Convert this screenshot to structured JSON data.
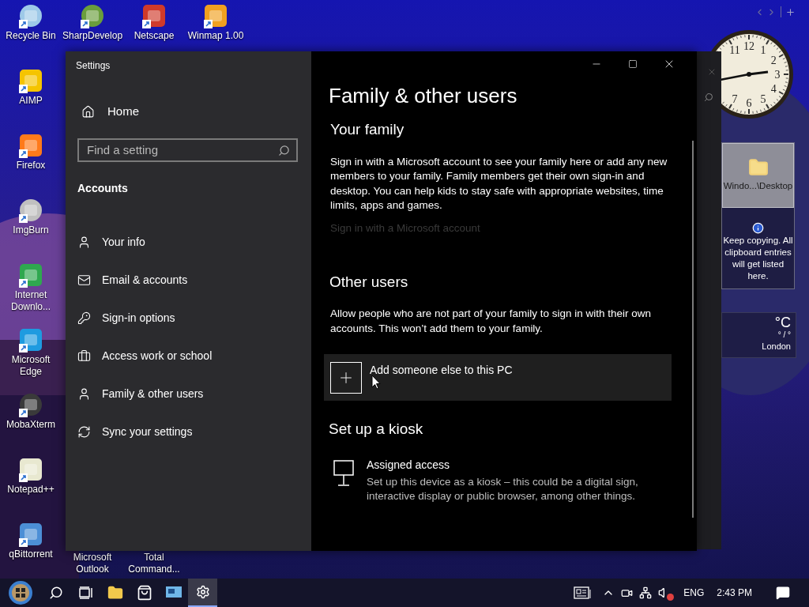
{
  "desktop_icons": {
    "column": [
      {
        "label": "Recycle Bin"
      },
      {
        "label": "AIMP"
      },
      {
        "label": "Firefox"
      },
      {
        "label": "ImgBurn"
      },
      {
        "label": "Internet Downlo..."
      },
      {
        "label": "Microsoft Edge"
      },
      {
        "label": "MobaXterm"
      },
      {
        "label": "Notepad++"
      },
      {
        "label": "qBittorrent"
      }
    ],
    "top_row": [
      {
        "label": "SharpDevelop"
      },
      {
        "label": "Netscape"
      },
      {
        "label": "Winmap 1.00"
      }
    ],
    "bottom_row": [
      {
        "label": "Microsoft Outlook"
      },
      {
        "label": "Total Command..."
      }
    ]
  },
  "settings": {
    "title": "Settings",
    "sidebar": {
      "home": "Home",
      "search": {
        "placeholder": "Find a setting"
      },
      "section": "Accounts",
      "items": [
        {
          "label": "Your info"
        },
        {
          "label": "Email & accounts"
        },
        {
          "label": "Sign-in options"
        },
        {
          "label": "Access work or school"
        },
        {
          "label": "Family & other users"
        },
        {
          "label": "Sync your settings"
        }
      ]
    },
    "content": {
      "title": "Family & other users",
      "your_family": {
        "heading": "Your family",
        "text": "Sign in with a Microsoft account to see your family here or add any new members to your family. Family members get their own sign-in and desktop. You can help kids to stay safe with appropriate websites, time limits, apps and games.",
        "link": {
          "label": "Sign in with a Microsoft account",
          "disabled": true
        }
      },
      "other_users": {
        "heading": "Other users",
        "text": "Allow people who are not part of your family to sign in with their own accounts. This won’t add them to your family.",
        "add_button": "Add someone else to this PC"
      },
      "kiosk": {
        "heading": "Set up a kiosk",
        "item_title": "Assigned access",
        "item_text": "Set up this device as a kiosk – this could be a digital sign, interactive display or public browser, among other things."
      }
    }
  },
  "gadgets": {
    "clock": {
      "numerals": [
        "11",
        "12",
        "1",
        "2",
        "3",
        "4",
        "5",
        "6",
        "7"
      ]
    },
    "clipboard": {
      "path": "Windo...\\Desktop",
      "message": "Keep copying. All clipboard entries will get listed here."
    },
    "weather": {
      "temperature": "°C",
      "range": "° / °",
      "city": "London"
    }
  },
  "taskbar": {
    "apps": [
      {
        "active": false
      },
      {
        "active": false
      },
      {
        "active": false
      },
      {
        "active": false
      },
      {
        "active": true
      }
    ],
    "language": "ENG",
    "time": "2:43 PM"
  }
}
